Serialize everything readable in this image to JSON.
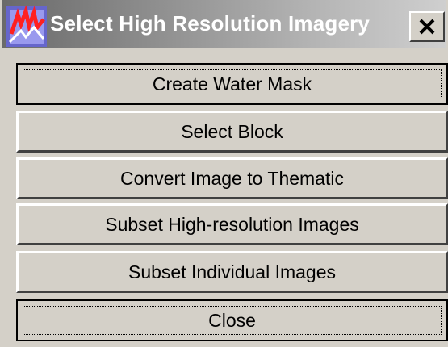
{
  "window": {
    "title": "Select High Resolution Imagery",
    "app_icon": "imagine-app-icon",
    "close_icon": "close-icon"
  },
  "buttons": [
    {
      "label": "Create Water Mask",
      "focused": true
    },
    {
      "label": "Select Block",
      "focused": false
    },
    {
      "label": "Convert Image to Thematic",
      "focused": false
    },
    {
      "label": "Subset High-resolution Images",
      "focused": false
    },
    {
      "label": "Subset Individual Images",
      "focused": false
    },
    {
      "label": "Close",
      "focused": true
    }
  ],
  "colors": {
    "face": "#d4d0c8",
    "titlebar_inactive": "#808080"
  }
}
